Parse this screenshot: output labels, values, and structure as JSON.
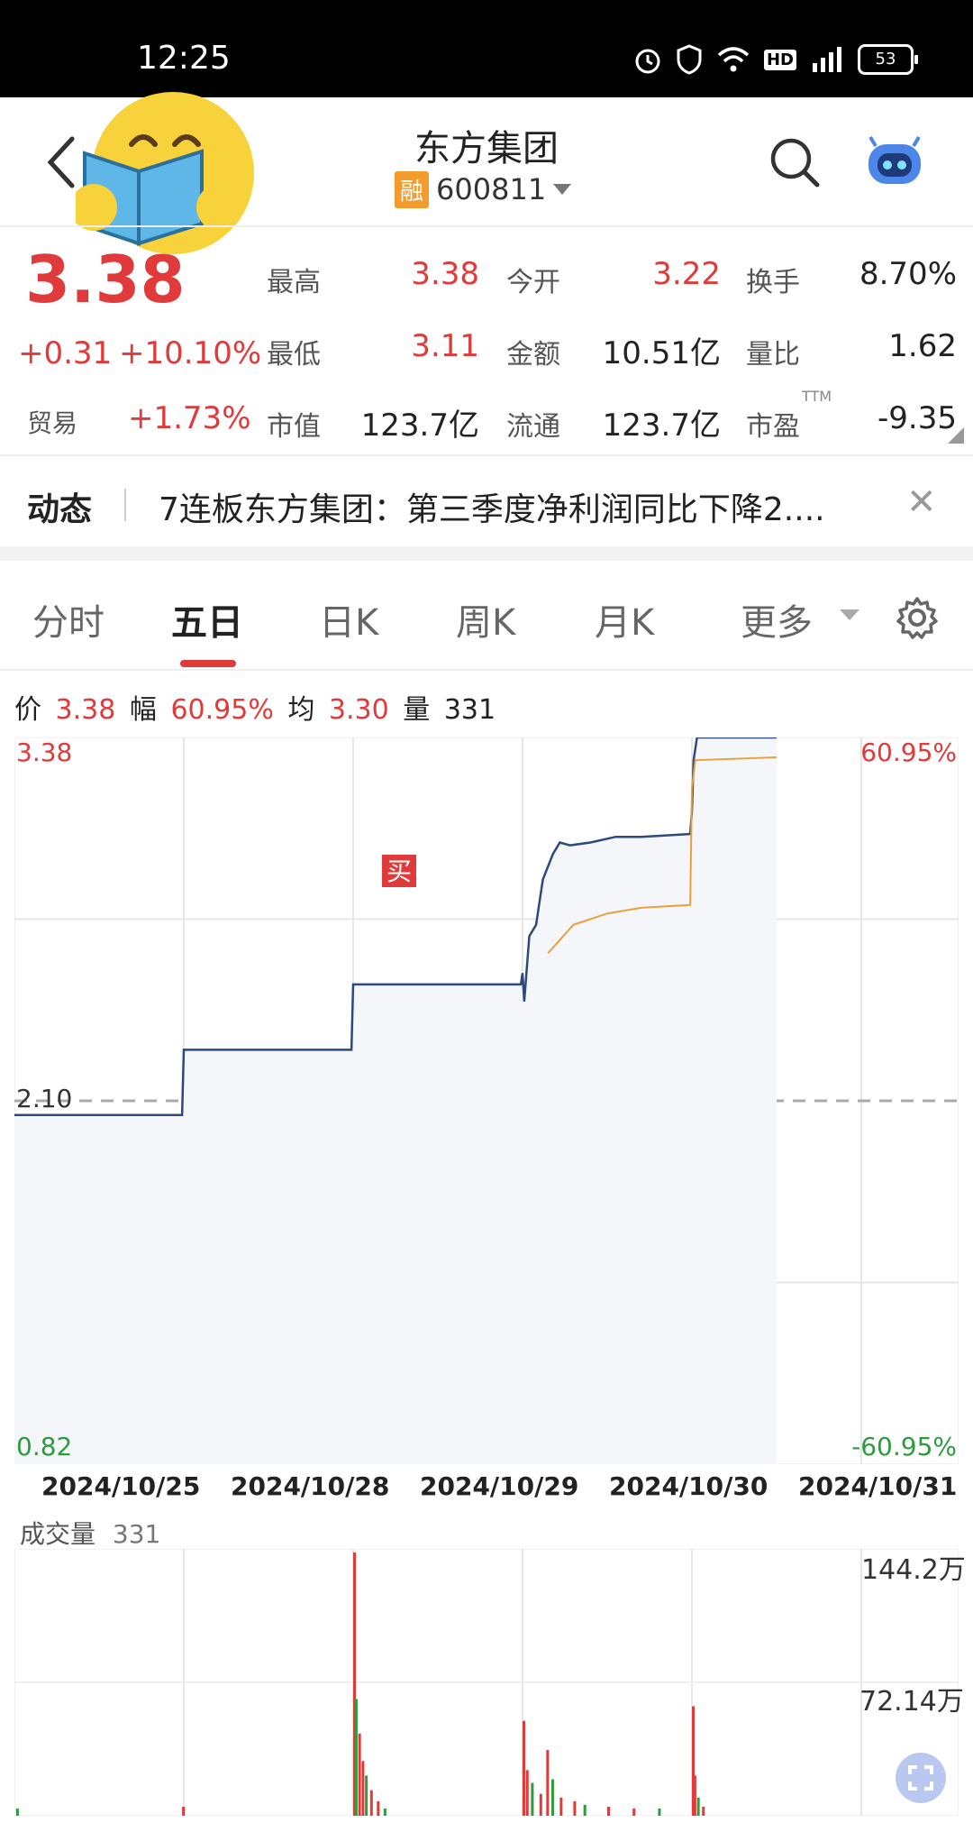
{
  "status_bar": {
    "time": "12:25",
    "battery": "53",
    "network": "5G",
    "hd": "HD"
  },
  "header": {
    "title": "东方集团",
    "badge": "融",
    "code": "600811"
  },
  "quote": {
    "price": "3.38",
    "change": "+0.31",
    "change_pct": "+10.10%",
    "trade_label": "贸易",
    "trade_pct": "+1.73%",
    "fields": [
      {
        "label": "最高",
        "value": "3.38",
        "color": "#e03a3a"
      },
      {
        "label": "今开",
        "value": "3.22",
        "color": "#e03a3a"
      },
      {
        "label": "换手",
        "value": "8.70%",
        "color": "#222222"
      },
      {
        "label": "最低",
        "value": "3.11",
        "color": "#e03a3a"
      },
      {
        "label": "金额",
        "value": "10.51亿",
        "color": "#222222"
      },
      {
        "label": "量比",
        "value": "1.62",
        "color": "#222222"
      },
      {
        "label": "市值",
        "value": "123.7亿",
        "color": "#222222"
      },
      {
        "label": "流通",
        "value": "123.7亿",
        "color": "#222222"
      },
      {
        "label": "市盈",
        "value": "-9.35",
        "color": "#222222",
        "sup": "TTM"
      }
    ]
  },
  "news": {
    "label": "动态",
    "text": "7连板东方集团：第三季度净利润同比下降2...."
  },
  "tabs": [
    "分时",
    "五日",
    "日K",
    "周K",
    "月K",
    "更多"
  ],
  "active_tab": 1,
  "info_row": {
    "price_label": "价",
    "price": "3.38",
    "amp_label": "幅",
    "amp": "60.95%",
    "avg_label": "均",
    "avg": "3.30",
    "vol_label": "量",
    "vol": "331"
  },
  "markers": {
    "buy": "买"
  },
  "chart_data": {
    "type": "line",
    "y_top": "3.38",
    "y_mid": "2.10",
    "y_bottom": "0.82",
    "pct_top": "60.95%",
    "pct_bottom": "-60.95%",
    "ylim": [
      0.82,
      3.38
    ],
    "reference": 2.1,
    "dates": [
      "2024/10/25",
      "2024/10/28",
      "2024/10/29",
      "2024/10/30",
      "2024/10/31"
    ],
    "series": [
      {
        "name": "价",
        "color": "#2c4a7c",
        "values": [
          [
            0,
            2.05
          ],
          [
            0.99,
            2.05
          ],
          [
            1.0,
            2.28
          ],
          [
            1.99,
            2.28
          ],
          [
            2.0,
            2.51
          ],
          [
            2.99,
            2.51
          ],
          [
            3.0,
            2.55
          ],
          [
            3.01,
            2.45
          ],
          [
            3.04,
            2.68
          ],
          [
            3.08,
            2.72
          ],
          [
            3.12,
            2.88
          ],
          [
            3.18,
            2.97
          ],
          [
            3.22,
            3.01
          ],
          [
            3.28,
            3.0
          ],
          [
            3.4,
            3.01
          ],
          [
            3.55,
            3.03
          ],
          [
            3.7,
            3.03
          ],
          [
            3.99,
            3.04
          ],
          [
            4.0,
            3.12
          ],
          [
            4.01,
            3.3
          ],
          [
            4.03,
            3.38
          ],
          [
            4.5,
            3.38
          ]
        ]
      },
      {
        "name": "均",
        "color": "#e8a23c",
        "values": [
          [
            3.15,
            2.62
          ],
          [
            3.3,
            2.72
          ],
          [
            3.5,
            2.76
          ],
          [
            3.7,
            2.78
          ],
          [
            3.99,
            2.79
          ],
          [
            4.0,
            3.2
          ],
          [
            4.02,
            3.3
          ],
          [
            4.5,
            3.31
          ]
        ]
      }
    ]
  },
  "volume": {
    "label": "成交量",
    "value": "331",
    "max_label": "144.2万",
    "mid_label": "72.14万",
    "max": 144.2,
    "spikes": [
      {
        "x": 0.01,
        "v": 4
      },
      {
        "x": 0.99,
        "v": 5
      },
      {
        "x": 2.0,
        "v": 144.2
      },
      {
        "x": 2.01,
        "v": 64
      },
      {
        "x": 2.03,
        "v": 45
      },
      {
        "x": 2.05,
        "v": 30
      },
      {
        "x": 2.07,
        "v": 22
      },
      {
        "x": 2.1,
        "v": 14
      },
      {
        "x": 2.14,
        "v": 8
      },
      {
        "x": 2.18,
        "v": 4
      },
      {
        "x": 3.0,
        "v": 52
      },
      {
        "x": 3.02,
        "v": 25
      },
      {
        "x": 3.05,
        "v": 18
      },
      {
        "x": 3.1,
        "v": 12
      },
      {
        "x": 3.14,
        "v": 36
      },
      {
        "x": 3.17,
        "v": 20
      },
      {
        "x": 3.22,
        "v": 10
      },
      {
        "x": 3.3,
        "v": 8
      },
      {
        "x": 3.36,
        "v": 6
      },
      {
        "x": 3.5,
        "v": 5
      },
      {
        "x": 3.65,
        "v": 4
      },
      {
        "x": 3.8,
        "v": 4
      },
      {
        "x": 4.0,
        "v": 60
      },
      {
        "x": 4.01,
        "v": 22
      },
      {
        "x": 4.03,
        "v": 10
      },
      {
        "x": 4.06,
        "v": 5
      }
    ]
  }
}
